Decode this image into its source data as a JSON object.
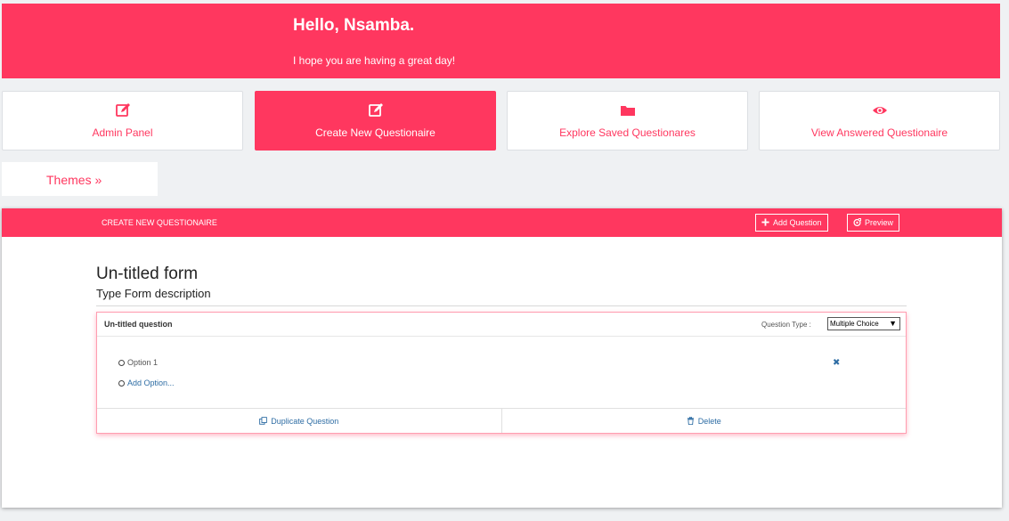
{
  "header": {
    "greeting": "Hello, Nsamba.",
    "subtitle": "I hope you are having a great day!"
  },
  "nav": {
    "cards": [
      {
        "label": "Admin Panel",
        "icon": "edit-icon",
        "active": false
      },
      {
        "label": "Create New Questionaire",
        "icon": "edit-icon",
        "active": true
      },
      {
        "label": "Explore Saved Questionares",
        "icon": "folder-icon",
        "active": false
      },
      {
        "label": "View Answered Questionaire",
        "icon": "eye-icon",
        "active": false
      }
    ]
  },
  "themes": {
    "label": "Themes »"
  },
  "panel": {
    "title": "CREATE NEW QUESTIONAIRE",
    "add_question_label": "Add Question",
    "preview_label": "Preview"
  },
  "form": {
    "title": "Un-titled form",
    "description": "Type Form description"
  },
  "question": {
    "title": "Un-titled question",
    "type_label": "Question Type :",
    "type_value": "Multiple Choice",
    "options": [
      "Option 1"
    ],
    "add_option_label": "Add Option...",
    "remove_icon": "x-icon",
    "duplicate_label": "Duplicate Question",
    "delete_label": "Delete"
  },
  "colors": {
    "accent": "#ff375f",
    "link": "#2e6da4",
    "background": "#eff1f3"
  }
}
